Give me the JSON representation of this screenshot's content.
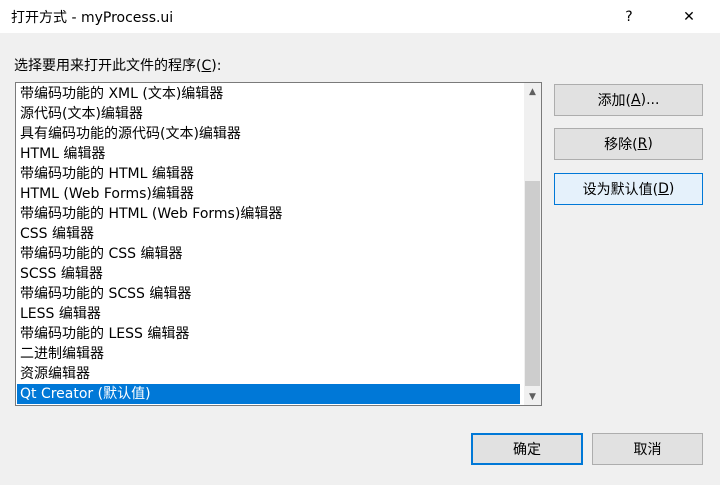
{
  "window": {
    "title": "打开方式 - myProcess.ui",
    "help_label": "?",
    "close_label": "✕"
  },
  "prompt": {
    "text_before": "选择要用来打开此文件的程序(",
    "mnemonic": "C",
    "text_after": "):"
  },
  "programs": [
    "带编码功能的 XML (文本)编辑器",
    "源代码(文本)编辑器",
    "具有编码功能的源代码(文本)编辑器",
    "HTML 编辑器",
    "带编码功能的 HTML 编辑器",
    "HTML (Web Forms)编辑器",
    "带编码功能的 HTML (Web Forms)编辑器",
    "CSS 编辑器",
    "带编码功能的 CSS 编辑器",
    "SCSS 编辑器",
    "带编码功能的 SCSS 编辑器",
    "LESS 编辑器",
    "带编码功能的 LESS 编辑器",
    "二进制编辑器",
    "资源编辑器",
    "Qt Creator (默认值)"
  ],
  "selected_index": 15,
  "scrollbar": {
    "up_icon": "chevron-up-icon",
    "down_icon": "chevron-down-icon"
  },
  "buttons": {
    "add": {
      "before": "添加(",
      "mnemonic": "A",
      "after": ")..."
    },
    "remove": {
      "before": "移除(",
      "mnemonic": "R",
      "after": ")"
    },
    "set_default": {
      "before": "设为默认值(",
      "mnemonic": "D",
      "after": ")"
    },
    "ok": "确定",
    "cancel": "取消"
  },
  "colors": {
    "selection": "#0078d7",
    "focus_border": "#0078d7"
  }
}
